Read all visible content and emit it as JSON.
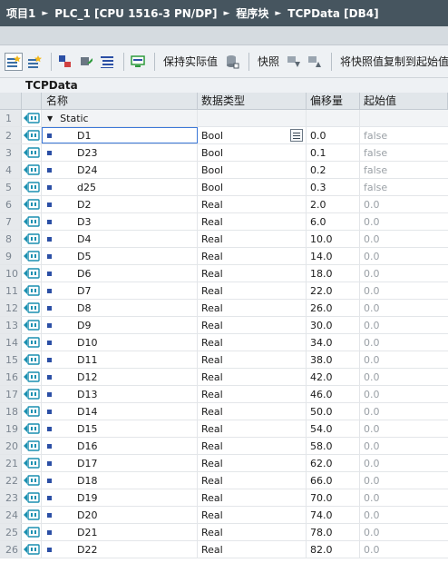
{
  "breadcrumb": {
    "items": [
      "项目1",
      "PLC_1 [CPU 1516-3 PN/DP]",
      "程序块",
      "TCPData [DB4]"
    ],
    "separator": "►"
  },
  "toolbar": {
    "keep_actual_label": "保持实际值",
    "snapshot_label": "快照",
    "copy_snapshot_label": "将快照值复制到起始值中"
  },
  "block_title": "TCPData",
  "columns": {
    "name": "名称",
    "data_type": "数据类型",
    "offset": "偏移量",
    "start_value": "起始值"
  },
  "colors": {
    "title_bar": "#46555f",
    "toolbar_bg": "#eef1f4",
    "interface_icon": "#1a8fb0",
    "member_marker": "#2b4fa5",
    "selection": "#3c78d8"
  },
  "icons": {
    "interface": "db-interface-icon",
    "member": "member-marker-icon",
    "expander": "triangle-down-icon",
    "picker": "list-picker-icon"
  },
  "rows": [
    {
      "num": "1",
      "name": "Static",
      "type": "",
      "offset": "",
      "start": ""
    },
    {
      "num": "2",
      "name": "D1",
      "type": "Bool",
      "offset": "0.0",
      "start": "false"
    },
    {
      "num": "3",
      "name": "D23",
      "type": "Bool",
      "offset": "0.1",
      "start": "false"
    },
    {
      "num": "4",
      "name": "D24",
      "type": "Bool",
      "offset": "0.2",
      "start": "false"
    },
    {
      "num": "5",
      "name": "d25",
      "type": "Bool",
      "offset": "0.3",
      "start": "false"
    },
    {
      "num": "6",
      "name": "D2",
      "type": "Real",
      "offset": "2.0",
      "start": "0.0"
    },
    {
      "num": "7",
      "name": "D3",
      "type": "Real",
      "offset": "6.0",
      "start": "0.0"
    },
    {
      "num": "8",
      "name": "D4",
      "type": "Real",
      "offset": "10.0",
      "start": "0.0"
    },
    {
      "num": "9",
      "name": "D5",
      "type": "Real",
      "offset": "14.0",
      "start": "0.0"
    },
    {
      "num": "10",
      "name": "D6",
      "type": "Real",
      "offset": "18.0",
      "start": "0.0"
    },
    {
      "num": "11",
      "name": "D7",
      "type": "Real",
      "offset": "22.0",
      "start": "0.0"
    },
    {
      "num": "12",
      "name": "D8",
      "type": "Real",
      "offset": "26.0",
      "start": "0.0"
    },
    {
      "num": "13",
      "name": "D9",
      "type": "Real",
      "offset": "30.0",
      "start": "0.0"
    },
    {
      "num": "14",
      "name": "D10",
      "type": "Real",
      "offset": "34.0",
      "start": "0.0"
    },
    {
      "num": "15",
      "name": "D11",
      "type": "Real",
      "offset": "38.0",
      "start": "0.0"
    },
    {
      "num": "16",
      "name": "D12",
      "type": "Real",
      "offset": "42.0",
      "start": "0.0"
    },
    {
      "num": "17",
      "name": "D13",
      "type": "Real",
      "offset": "46.0",
      "start": "0.0"
    },
    {
      "num": "18",
      "name": "D14",
      "type": "Real",
      "offset": "50.0",
      "start": "0.0"
    },
    {
      "num": "19",
      "name": "D15",
      "type": "Real",
      "offset": "54.0",
      "start": "0.0"
    },
    {
      "num": "20",
      "name": "D16",
      "type": "Real",
      "offset": "58.0",
      "start": "0.0"
    },
    {
      "num": "21",
      "name": "D17",
      "type": "Real",
      "offset": "62.0",
      "start": "0.0"
    },
    {
      "num": "22",
      "name": "D18",
      "type": "Real",
      "offset": "66.0",
      "start": "0.0"
    },
    {
      "num": "23",
      "name": "D19",
      "type": "Real",
      "offset": "70.0",
      "start": "0.0"
    },
    {
      "num": "24",
      "name": "D20",
      "type": "Real",
      "offset": "74.0",
      "start": "0.0"
    },
    {
      "num": "25",
      "name": "D21",
      "type": "Real",
      "offset": "78.0",
      "start": "0.0"
    },
    {
      "num": "26",
      "name": "D22",
      "type": "Real",
      "offset": "82.0",
      "start": "0.0"
    }
  ]
}
